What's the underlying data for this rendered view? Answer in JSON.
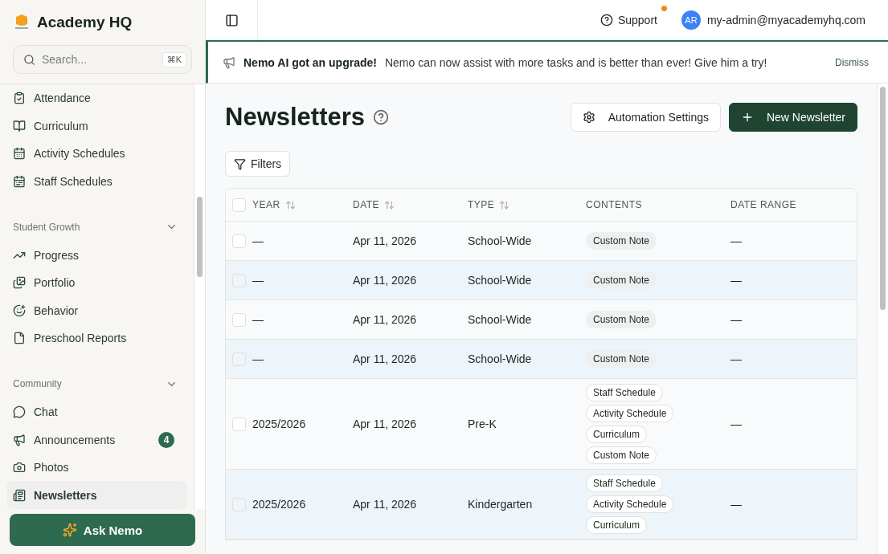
{
  "brand": {
    "name": "Academy HQ"
  },
  "search": {
    "placeholder": "Search...",
    "shortcut": "⌘K"
  },
  "sidebar": {
    "sections": [
      {
        "items": [
          {
            "label": "Attendance",
            "selected": false
          },
          {
            "label": "Curriculum",
            "selected": false
          },
          {
            "label": "Activity Schedules",
            "selected": false
          },
          {
            "label": "Staff Schedules",
            "selected": false
          }
        ]
      },
      {
        "title": "Student Growth",
        "items": [
          {
            "label": "Progress",
            "selected": false
          },
          {
            "label": "Portfolio",
            "selected": false
          },
          {
            "label": "Behavior",
            "selected": false
          },
          {
            "label": "Preschool Reports",
            "selected": false
          }
        ]
      },
      {
        "title": "Community",
        "items": [
          {
            "label": "Chat",
            "selected": false
          },
          {
            "label": "Announcements",
            "selected": false,
            "badge": "4"
          },
          {
            "label": "Photos",
            "selected": false
          },
          {
            "label": "Newsletters",
            "selected": true
          }
        ]
      }
    ]
  },
  "ask_button": {
    "label": "Ask Nemo"
  },
  "topbar": {
    "support": "Support",
    "support_notification": true,
    "avatar_initials": "AR",
    "user_email": "my-admin@myacademyhq.com"
  },
  "banner": {
    "title": "Nemo AI got an upgrade!",
    "message": "Nemo can now assist with more tasks and is better than ever! Give him a try!",
    "dismiss": "Dismiss"
  },
  "page": {
    "title": "Newsletters",
    "actions": [
      {
        "label": "Automation Settings",
        "kind": "secondary"
      },
      {
        "label": "New Newsletter",
        "kind": "primary"
      }
    ],
    "filters": "Filters"
  },
  "table": {
    "select_all_checked": false,
    "columns": [
      {
        "label": "YEAR",
        "sortable": true
      },
      {
        "label": "DATE",
        "sortable": true
      },
      {
        "label": "TYPE",
        "sortable": true
      },
      {
        "label": "CONTENTS",
        "sortable": false
      },
      {
        "label": "DATE RANGE",
        "sortable": false
      }
    ],
    "rows": [
      {
        "checked": false,
        "year": "—",
        "date": "Apr 11, 2026",
        "type": "School-Wide",
        "contents": [
          "Custom Note"
        ],
        "date_range": "—"
      },
      {
        "checked": false,
        "year": "—",
        "date": "Apr 11, 2026",
        "type": "School-Wide",
        "contents": [
          "Custom Note"
        ],
        "date_range": "—"
      },
      {
        "checked": false,
        "year": "—",
        "date": "Apr 11, 2026",
        "type": "School-Wide",
        "contents": [
          "Custom Note"
        ],
        "date_range": "—"
      },
      {
        "checked": false,
        "year": "—",
        "date": "Apr 11, 2026",
        "type": "School-Wide",
        "contents": [
          "Custom Note"
        ],
        "date_range": "—"
      },
      {
        "checked": false,
        "year": "2025/2026",
        "date": "Apr 11, 2026",
        "type": "Pre-K",
        "contents": [
          "Staff Schedule",
          "Activity Schedule",
          "Curriculum",
          "Custom Note"
        ],
        "date_range": "—"
      },
      {
        "checked": false,
        "year": "2025/2026",
        "date": "Apr 11, 2026",
        "type": "Kindergarten",
        "contents": [
          "Staff Schedule",
          "Activity Schedule",
          "Curriculum"
        ],
        "date_range": "—"
      }
    ]
  }
}
